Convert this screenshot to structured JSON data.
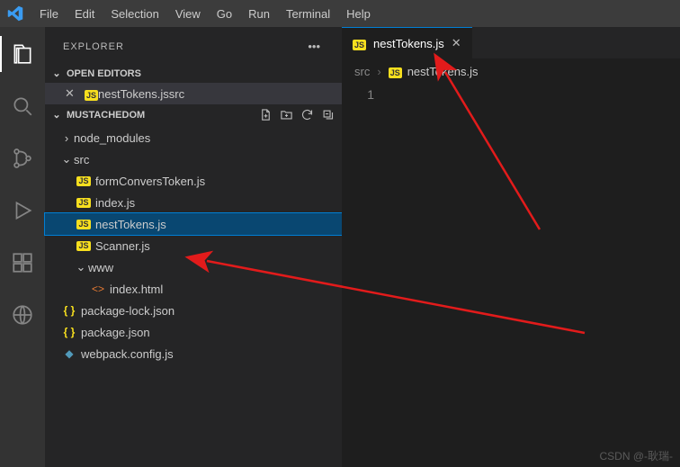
{
  "menu": [
    "File",
    "Edit",
    "Selection",
    "View",
    "Go",
    "Run",
    "Terminal",
    "Help"
  ],
  "sidebar": {
    "title": "EXPLORER",
    "openEditors": {
      "title": "OPEN EDITORS",
      "file": "nestTokens.js",
      "folder": "src"
    },
    "project": "MUSTACHEDOM",
    "tree": {
      "node_modules": "node_modules",
      "src": "src",
      "formConvers": "formConversToken.js",
      "indexjs": "index.js",
      "nestTokens": "nestTokens.js",
      "scanner": "Scanner.js",
      "www": "www",
      "indexhtml": "index.html",
      "pkglock": "package-lock.json",
      "pkg": "package.json",
      "webpack": "webpack.config.js"
    }
  },
  "editor": {
    "tabFile": "nestTokens.js",
    "crumbFolder": "src",
    "crumbFile": "nestTokens.js",
    "line1": "1"
  },
  "watermark": "CSDN @-耿瑞-"
}
